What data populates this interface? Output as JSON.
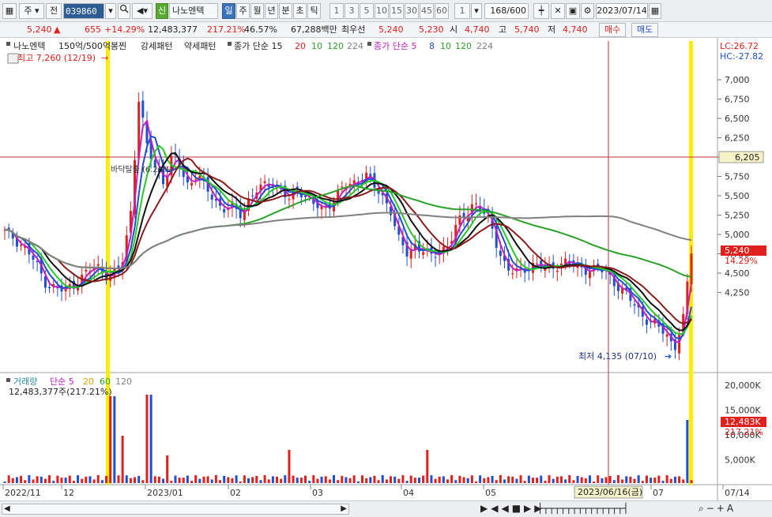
{
  "toolbar": {
    "period_main": "주",
    "prev_label": "전",
    "code": "039860",
    "new_badge": "신",
    "stock_name": "나노엔텍",
    "period_tabs": [
      "일",
      "주",
      "월",
      "년",
      "분",
      "초",
      "틱"
    ],
    "active_tab": "일",
    "minute_options": [
      "1",
      "3",
      "5",
      "10",
      "15",
      "30",
      "45",
      "60"
    ],
    "multiplier": "1",
    "range": "168",
    "range_total": "/600",
    "date": "2023/07/14"
  },
  "quote": {
    "price": "5,240",
    "change_arrow": "▲",
    "change": "655",
    "change_pct": "+14.29%",
    "volume": "12,483,377",
    "volume_pct": "217.21%",
    "turnover_pct": "46.57%",
    "amount": "67,288백만",
    "priority_label": "최우선",
    "ask": "5,240",
    "bid": "5,230",
    "open_label": "시",
    "open": "4,740",
    "high_label": "고",
    "high": "5,740",
    "low_label": "저",
    "low": "4,740",
    "buy_button": "매수",
    "sell_button": "매도"
  },
  "legend": {
    "name": "나노엔텍",
    "pattern": "150억/500억봉찐",
    "strong": "강세패턴",
    "weak": "약세패턴",
    "ma1_label": "종가 단순 15",
    "ma1_periods": [
      "20",
      "10",
      "120",
      "224"
    ],
    "ma2_label": "종가 단순 5",
    "ma2_periods": [
      "8",
      "10",
      "120",
      "224"
    ],
    "lc": "LC:26.72",
    "hc": "HC:-27.82"
  },
  "annotations": {
    "high": "최고 7,260 (12/19)",
    "low": "최저 4,135 (07/10)",
    "mid": "바닥탈출 (6.26%)"
  },
  "price_axis": [
    "7,000",
    "6,750",
    "6,500",
    "6,250",
    "6,000",
    "5,750",
    "5,500",
    "5,250",
    "5,000",
    "4,750",
    "4,500",
    "4,250"
  ],
  "price_tags": {
    "crosshair": "6,205",
    "current": "5,240",
    "current_pct": "14.29%"
  },
  "volume_panel": {
    "legend_label": "거래량",
    "ma_label": "단순 5",
    "ma_periods": [
      "20",
      "60",
      "120"
    ],
    "value": "12,483,377주(217.21%)",
    "axis": [
      "20,000K",
      "15,000K",
      "10,000K",
      "5,000K"
    ],
    "current": "12,483K",
    "current_pct": "217.21%"
  },
  "date_axis": [
    "2022/11",
    "12",
    "2023/01",
    "02",
    "03",
    "04",
    "05",
    "06",
    "07",
    "07/14"
  ],
  "crosshair_date": "2023/06/16(금)",
  "colors": {
    "up": "#e0201c",
    "down": "#1f4fd0",
    "highlight": "#ffee00",
    "ma_gray": "#808080",
    "ma_green": "#2aa02a"
  },
  "chart_data": {
    "type": "candlestick",
    "ylim": [
      4100,
      7300
    ],
    "close_path": [
      5420,
      5380,
      5300,
      5200,
      5050,
      4900,
      4850,
      4820,
      4880,
      4950,
      5020,
      5080,
      5000,
      4980,
      5100,
      5600,
      6800,
      6300,
      6100,
      5950,
      6200,
      6100,
      5900,
      6050,
      5850,
      5800,
      5650,
      5700,
      5600,
      5750,
      5850,
      5900,
      5950,
      5850,
      5750,
      5900,
      5800,
      5700,
      5650,
      5750,
      5850,
      5900,
      5950,
      6050,
      5900,
      5800,
      5700,
      5350,
      5200,
      5300,
      5250,
      5150,
      5250,
      5300,
      5500,
      5600,
      5750,
      5650,
      5500,
      5250,
      5050,
      5000,
      5050,
      5100,
      5080,
      5050,
      5100,
      5120,
      5080,
      5060,
      5050,
      5040,
      5000,
      4900,
      4800,
      4700,
      4600,
      4500,
      4450,
      4380,
      4250,
      4500,
      5240
    ]
  }
}
